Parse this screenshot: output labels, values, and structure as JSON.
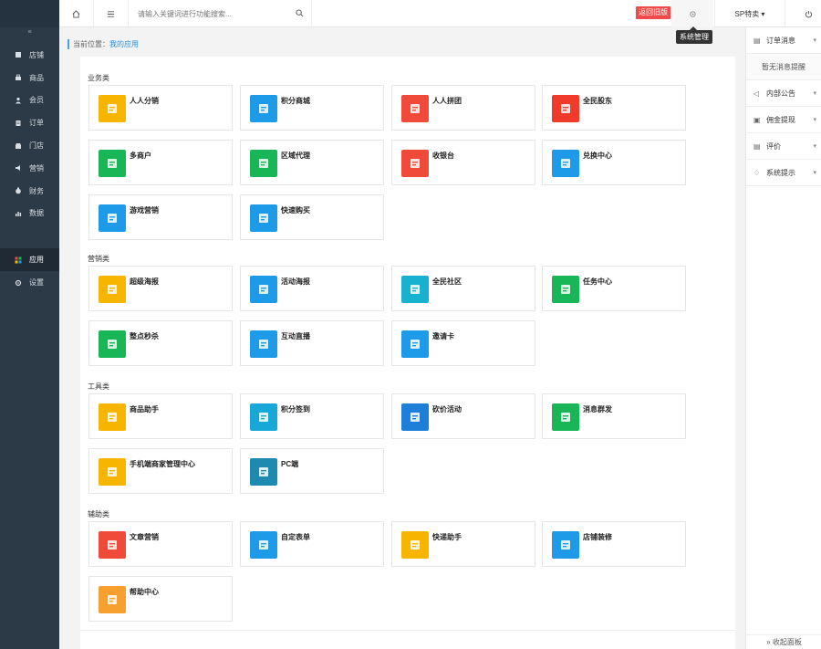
{
  "sidebar": {
    "collapse_glyph": "≡",
    "items": [
      {
        "label": "店铺",
        "icon": "store-icon"
      },
      {
        "label": "商品",
        "icon": "goods-icon"
      },
      {
        "label": "会员",
        "icon": "member-icon"
      },
      {
        "label": "订单",
        "icon": "order-icon"
      },
      {
        "label": "门店",
        "icon": "shop-icon"
      },
      {
        "label": "营销",
        "icon": "marketing-icon"
      },
      {
        "label": "财务",
        "icon": "finance-icon"
      },
      {
        "label": "数据",
        "icon": "data-icon"
      }
    ],
    "active_item": {
      "label": "应用",
      "icon": "apps-icon"
    },
    "settings_item": {
      "label": "设置",
      "icon": "settings-icon"
    }
  },
  "topbar": {
    "search_placeholder": "请输入关键词进行功能搜索...",
    "old_version_label": "返回旧版",
    "system_manage_tooltip": "系统管理",
    "user_label": "SP特卖 ▾"
  },
  "breadcrumb": {
    "prefix": "当前位置：",
    "current": "我的应用"
  },
  "categories": [
    {
      "title": "业务类",
      "apps": [
        {
          "name": "人人分销",
          "color": "#f7b500",
          "icon": "distribution-icon"
        },
        {
          "name": "积分商城",
          "color": "#1e9be8",
          "icon": "points-mall-icon"
        },
        {
          "name": "人人拼团",
          "color": "#f04a3a",
          "icon": "group-buy-icon"
        },
        {
          "name": "全民股东",
          "color": "#f03a2a",
          "icon": "shareholder-icon"
        },
        {
          "name": "多商户",
          "color": "#18b657",
          "icon": "multi-merchant-icon"
        },
        {
          "name": "区域代理",
          "color": "#18b657",
          "icon": "region-agent-icon"
        },
        {
          "name": "收银台",
          "color": "#f04a3a",
          "icon": "cashier-icon"
        },
        {
          "name": "兑换中心",
          "color": "#1e9be8",
          "icon": "exchange-center-icon"
        },
        {
          "name": "游戏营销",
          "color": "#1e9be8",
          "icon": "game-marketing-icon"
        },
        {
          "name": "快速购买",
          "color": "#1e9be8",
          "icon": "quick-buy-icon"
        }
      ]
    },
    {
      "title": "营销类",
      "apps": [
        {
          "name": "超级海报",
          "color": "#f7b500",
          "icon": "poster-icon"
        },
        {
          "name": "活动海报",
          "color": "#1e9be8",
          "icon": "activity-poster-icon"
        },
        {
          "name": "全民社区",
          "color": "#18b2d0",
          "icon": "community-icon"
        },
        {
          "name": "任务中心",
          "color": "#18b657",
          "icon": "task-center-icon"
        },
        {
          "name": "整点秒杀",
          "color": "#18b657",
          "icon": "flash-sale-icon"
        },
        {
          "name": "互动直播",
          "color": "#1e9be8",
          "icon": "live-icon"
        },
        {
          "name": "邀请卡",
          "color": "#1e9be8",
          "icon": "invite-card-icon"
        }
      ]
    },
    {
      "title": "工具类",
      "apps": [
        {
          "name": "商品助手",
          "color": "#f7b500",
          "icon": "goods-helper-icon"
        },
        {
          "name": "积分签到",
          "color": "#18a8d8",
          "icon": "sign-in-icon"
        },
        {
          "name": "砍价活动",
          "color": "#1e7fd8",
          "icon": "bargain-icon"
        },
        {
          "name": "消息群发",
          "color": "#18b657",
          "icon": "message-icon"
        },
        {
          "name": "手机端商家管理中心",
          "color": "#f7b500",
          "icon": "mobile-manage-icon"
        },
        {
          "name": "PC端",
          "color": "#1e8ab0",
          "icon": "pc-icon"
        }
      ]
    },
    {
      "title": "辅助类",
      "apps": [
        {
          "name": "文章营销",
          "color": "#f04a3a",
          "icon": "article-icon"
        },
        {
          "name": "自定表单",
          "color": "#1e9be8",
          "icon": "form-icon"
        },
        {
          "name": "快递助手",
          "color": "#f7b500",
          "icon": "express-icon"
        },
        {
          "name": "店铺装修",
          "color": "#1e9be8",
          "icon": "decorate-icon"
        },
        {
          "name": "帮助中心",
          "color": "#f7a030",
          "icon": "help-center-icon"
        }
      ]
    }
  ],
  "right_panel": {
    "order_msg": "订单消息",
    "empty_msg": "暂无消息提醒",
    "items": [
      {
        "label": "内部公告",
        "icon": "announce-icon"
      },
      {
        "label": "佣金提现",
        "icon": "withdraw-icon"
      },
      {
        "label": "评价",
        "icon": "review-icon"
      },
      {
        "label": "系统提示",
        "icon": "bell-icon"
      }
    ],
    "collapse_label": "» 收起面板"
  }
}
